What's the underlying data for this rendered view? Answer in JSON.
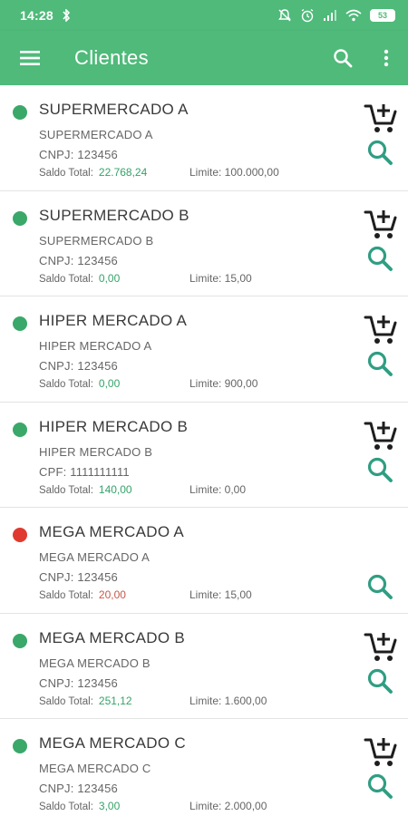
{
  "status_bar": {
    "time": "14:28",
    "battery": "53",
    "icons": [
      "sync-icon",
      "mute-icon",
      "alarm-icon",
      "signal-icon",
      "wifi-icon",
      "battery-icon"
    ]
  },
  "app_bar": {
    "title": "Clientes",
    "icons": [
      "menu-icon",
      "search-icon",
      "more-vert-icon"
    ]
  },
  "colors": {
    "primary": "#4fba7a",
    "status_ok": "#3aa869",
    "status_blocked": "#e03a30",
    "value_positive": "#35a36a",
    "value_negative": "#c8574a",
    "action_icon": "#2f9e82"
  },
  "labels": {
    "saldo": "Saldo Total:"
  },
  "clients": [
    {
      "name": "SUPERMERCADO A",
      "subtitle": "SUPERMERCADO A",
      "doc": "CNPJ: 123456",
      "saldo": "22.768,24",
      "limite": "Limite: 100.000,00",
      "status": "ok",
      "saldo_color": "positive",
      "can_order": true
    },
    {
      "name": "SUPERMERCADO B",
      "subtitle": "SUPERMERCADO B",
      "doc": "CNPJ: 123456",
      "saldo": "0,00",
      "limite": "Limite: 15,00",
      "status": "ok",
      "saldo_color": "positive",
      "can_order": true
    },
    {
      "name": "HIPER MERCADO A",
      "subtitle": "HIPER MERCADO A",
      "doc": "CNPJ: 123456",
      "saldo": "0,00",
      "limite": "Limite: 900,00",
      "status": "ok",
      "saldo_color": "positive",
      "can_order": true
    },
    {
      "name": "HIPER MERCADO B",
      "subtitle": "HIPER MERCADO B",
      "doc": "CPF: 1111111111",
      "saldo": "140,00",
      "limite": "Limite: 0,00",
      "status": "ok",
      "saldo_color": "positive",
      "can_order": true
    },
    {
      "name": "MEGA MERCADO A",
      "subtitle": "MEGA MERCADO A",
      "doc": "CNPJ: 123456",
      "saldo": "20,00",
      "limite": "Limite: 15,00",
      "status": "blocked",
      "saldo_color": "negative",
      "can_order": false
    },
    {
      "name": "MEGA MERCADO B",
      "subtitle": "MEGA MERCADO B",
      "doc": "CNPJ: 123456",
      "saldo": "251,12",
      "limite": "Limite: 1.600,00",
      "status": "ok",
      "saldo_color": "positive",
      "can_order": true
    },
    {
      "name": "MEGA MERCADO C",
      "subtitle": "MEGA MERCADO C",
      "doc": "CNPJ: 123456",
      "saldo": "3,00",
      "limite": "Limite: 2.000,00",
      "status": "ok",
      "saldo_color": "positive",
      "can_order": true
    }
  ]
}
